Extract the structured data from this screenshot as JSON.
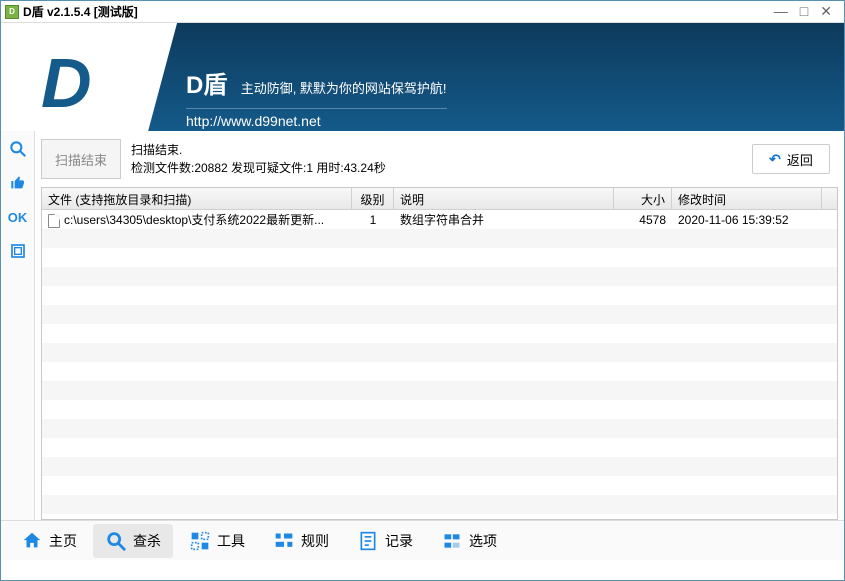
{
  "window": {
    "title": "D盾 v2.1.5.4 [测试版]"
  },
  "header": {
    "brand": "D盾",
    "slogan": "主动防御, 默默为你的网站保驾护航!",
    "url": "http://www.d99net.net"
  },
  "sidebar": {
    "ok_label": "OK"
  },
  "actions": {
    "scan_button": "扫描结束",
    "status_line1": "扫描结束.",
    "status_line2": "检测文件数:20882 发现可疑文件:1 用时:43.24秒",
    "return_button": "返回"
  },
  "table": {
    "headers": {
      "file": "文件 (支持拖放目录和扫描)",
      "level": "级别",
      "desc": "说明",
      "size": "大小",
      "time": "修改时间"
    },
    "rows": [
      {
        "file": "c:\\users\\34305\\desktop\\支付系统2022最新更新...",
        "level": "1",
        "desc": "数组字符串合并",
        "size": "4578",
        "time": "2020-11-06 15:39:52"
      }
    ]
  },
  "nav": {
    "home": "主页",
    "scan": "查杀",
    "tools": "工具",
    "rules": "规则",
    "logs": "记录",
    "options": "选项"
  }
}
